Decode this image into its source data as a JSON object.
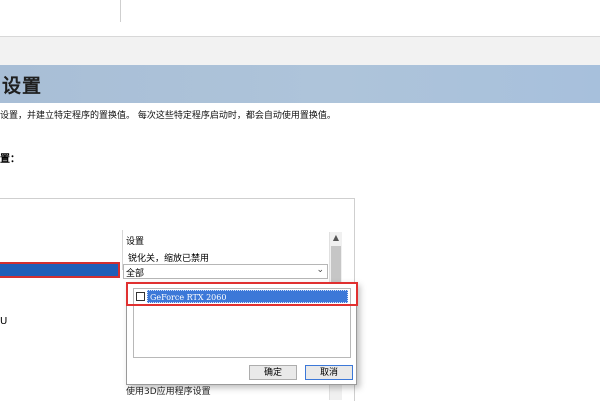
{
  "page": {
    "title": "设置",
    "description": "设置，并建立特定程序的置换值。 每次这些特定程序启动时，都会自动使用置换值。",
    "section_label": "置："
  },
  "settings_table": {
    "column_header": "设置",
    "setting_value": "锐化关，缩放已禁用",
    "dropdown_value": "全部",
    "left_partial_text": "U"
  },
  "popup": {
    "items": [
      {
        "label": "GeForce RTX 2060",
        "checked": false
      }
    ],
    "ok_label": "确定",
    "cancel_label": "取消"
  },
  "bottom_partial_text": "使用3D应用程序设置",
  "colors": {
    "header_bg": "#aec4da",
    "selection": "#3c78d8",
    "highlight_frame": "#e03030"
  }
}
